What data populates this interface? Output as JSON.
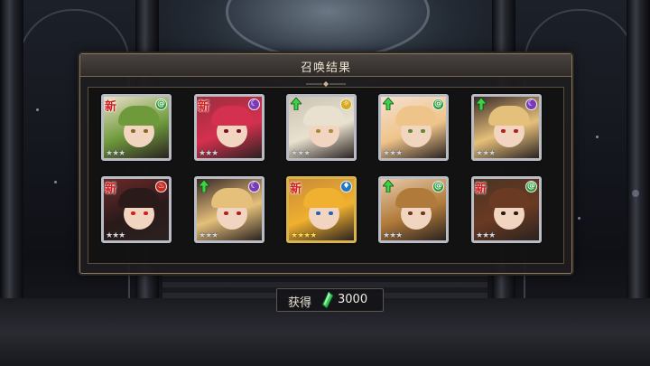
{
  "window": {
    "title": "召唤结果"
  },
  "cards": [
    {
      "new_label": "新",
      "is_new": true,
      "upgrade": false,
      "element": "green",
      "element_icon": "spiral-icon",
      "stars": "★★★",
      "frame": "silver",
      "hair": "#6f9a3c",
      "bg": "#e9dfc6",
      "eye": "#8a6a1a"
    },
    {
      "new_label": "新",
      "is_new": true,
      "upgrade": false,
      "element": "purple",
      "element_icon": "crescent-moon-icon",
      "stars": "★★★",
      "frame": "silver",
      "hair": "#d4304f",
      "bg": "#9b2d3e",
      "eye": "#7a1020"
    },
    {
      "new_label": "",
      "is_new": false,
      "upgrade": true,
      "element": "yellow",
      "element_icon": "sun-icon",
      "stars": "★★★",
      "frame": "silver",
      "hair": "#e8e1cf",
      "bg": "#c9c3b4",
      "eye": "#a88a3a"
    },
    {
      "new_label": "",
      "is_new": false,
      "upgrade": true,
      "element": "green",
      "element_icon": "spiral-icon",
      "stars": "★★★",
      "frame": "silver",
      "hair": "#efc48a",
      "bg": "#f4e0d0",
      "eye": "#5a8a2a"
    },
    {
      "new_label": "",
      "is_new": false,
      "upgrade": true,
      "element": "purple",
      "element_icon": "crescent-moon-icon",
      "stars": "★★★",
      "frame": "silver",
      "hair": "#e5c07a",
      "bg": "#3a2a28",
      "eye": "#b02020"
    },
    {
      "new_label": "新",
      "is_new": true,
      "upgrade": false,
      "element": "red",
      "element_icon": "flame-icon",
      "stars": "★★★",
      "frame": "silver",
      "hair": "#2a1a1a",
      "bg": "#6a2a2a",
      "eye": "#d02020"
    },
    {
      "new_label": "",
      "is_new": false,
      "upgrade": true,
      "element": "purple",
      "element_icon": "crescent-moon-icon",
      "stars": "★★★",
      "frame": "silver",
      "hair": "#e5c07a",
      "bg": "#3a2a28",
      "eye": "#b02020"
    },
    {
      "new_label": "新",
      "is_new": true,
      "upgrade": false,
      "element": "blue",
      "element_icon": "water-drop-icon",
      "stars": "★★★★",
      "frame": "gold",
      "hair": "#f0b030",
      "bg": "#c88a38",
      "eye": "#2a60b0"
    },
    {
      "new_label": "",
      "is_new": false,
      "upgrade": true,
      "element": "green",
      "element_icon": "spiral-icon",
      "stars": "★★★",
      "frame": "silver",
      "hair": "#b07a3a",
      "bg": "#e6c9a8",
      "eye": "#6a3a1a"
    },
    {
      "new_label": "新",
      "is_new": true,
      "upgrade": false,
      "element": "green",
      "element_icon": "spiral-icon",
      "stars": "★★★",
      "frame": "silver",
      "hair": "#6a3a22",
      "bg": "#4a3424",
      "eye": "#2a1a10"
    }
  ],
  "reward": {
    "label": "获得",
    "icon": "green-crystal-icon",
    "amount": "3000"
  },
  "colors": {
    "green": "#2f9a3a",
    "purple": "#7a3ab8",
    "yellow": "#d7a818",
    "red": "#c8281e",
    "blue": "#1e78c8",
    "frame_silver": "#b9bcc4",
    "frame_gold": "#d8b44a"
  }
}
